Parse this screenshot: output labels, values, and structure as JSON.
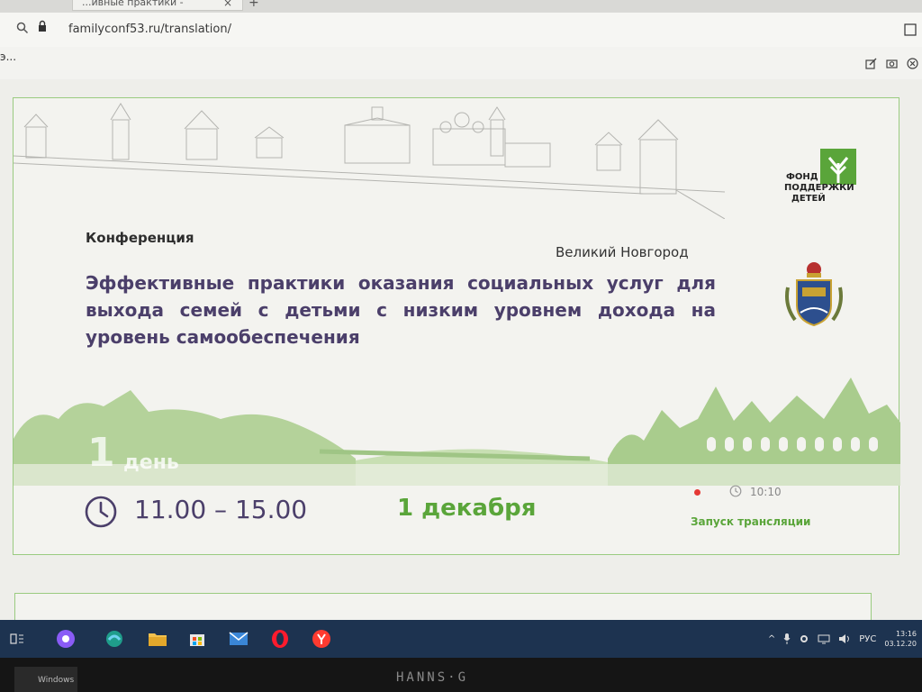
{
  "browser": {
    "tab_title": "...ивные практики -",
    "tab_close": "×",
    "tab_new": "+",
    "url": "familyconf53.ru/translation/",
    "toolbar_left": "э..."
  },
  "conference": {
    "label": "Конференция",
    "city": "Великий Новгород",
    "title": "Эффективные практики оказания социальных услуг для выхода семей с детьми с низким уровнем дохода на уровень самообеспечения",
    "day_number": "1",
    "day_word": "день",
    "time_range": "11.00 – 15.00",
    "date": "1 декабря",
    "stream_time": "10:10",
    "launch_label": "Запуск трансляции"
  },
  "fund_logo": {
    "line1": "ФОНД",
    "line2": "ПОДДЕРЖКИ",
    "line3": "ДЕТЕЙ"
  },
  "taskbar": {
    "lang": "РУС",
    "time": "13:16",
    "date": "03.12.20"
  },
  "monitor": {
    "brand": "HANNS·G",
    "sticker": "Windows"
  },
  "colors": {
    "title_purple": "#4b3f6a",
    "accent_green": "#5aa53a",
    "card_border": "#9acb80",
    "live_red": "#e53935",
    "taskbar": "#1d3350"
  }
}
